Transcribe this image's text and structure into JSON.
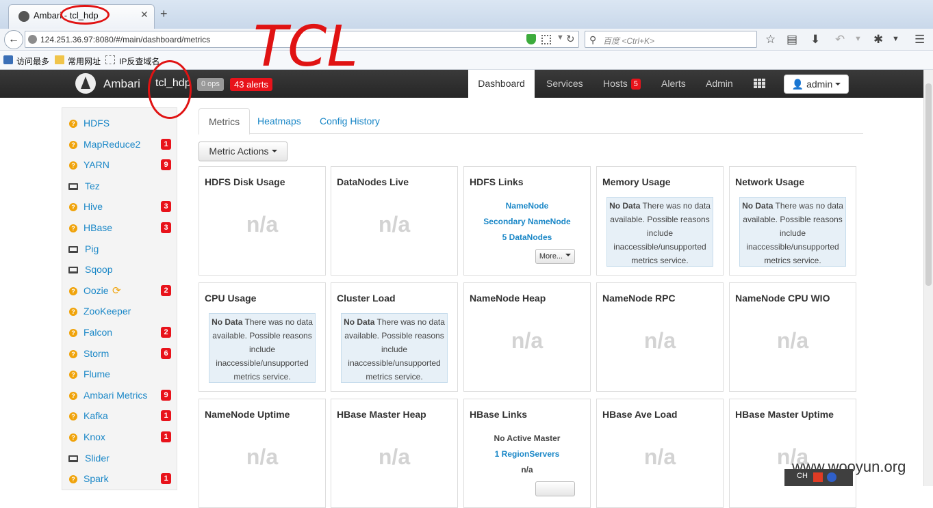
{
  "browser": {
    "tab_title": "Ambari - tcl_hdp",
    "url": "124.251.36.97:8080/#/main/dashboard/metrics",
    "search_placeholder": "百度 <Ctrl+K>",
    "bookmarks": [
      "访问最多",
      "常用网址",
      "IP反查域名"
    ]
  },
  "topnav": {
    "brand": "Ambari",
    "cluster": "tcl_hdp",
    "ops": "0 ops",
    "alerts": "43 alerts",
    "items": [
      "Dashboard",
      "Services",
      "Hosts",
      "Alerts",
      "Admin"
    ],
    "hosts_badge": "5",
    "user": "admin"
  },
  "annotation_text": "TCL",
  "sidebar": {
    "services": [
      {
        "name": "HDFS",
        "icon": "question-icon",
        "badge": ""
      },
      {
        "name": "MapReduce2",
        "icon": "question-icon",
        "badge": "1"
      },
      {
        "name": "YARN",
        "icon": "question-icon",
        "badge": "9"
      },
      {
        "name": "Tez",
        "icon": "laptop-icon",
        "badge": ""
      },
      {
        "name": "Hive",
        "icon": "question-icon",
        "badge": "3"
      },
      {
        "name": "HBase",
        "icon": "question-icon",
        "badge": "3"
      },
      {
        "name": "Pig",
        "icon": "laptop-icon",
        "badge": ""
      },
      {
        "name": "Sqoop",
        "icon": "laptop-icon",
        "badge": ""
      },
      {
        "name": "Oozie",
        "icon": "question-icon",
        "badge": "2"
      },
      {
        "name": "ZooKeeper",
        "icon": "question-icon",
        "badge": ""
      },
      {
        "name": "Falcon",
        "icon": "question-icon",
        "badge": "2"
      },
      {
        "name": "Storm",
        "icon": "question-icon",
        "badge": "6"
      },
      {
        "name": "Flume",
        "icon": "question-icon",
        "badge": ""
      },
      {
        "name": "Ambari Metrics",
        "icon": "question-icon",
        "badge": "9"
      },
      {
        "name": "Kafka",
        "icon": "question-icon",
        "badge": "1"
      },
      {
        "name": "Knox",
        "icon": "question-icon",
        "badge": "1"
      },
      {
        "name": "Slider",
        "icon": "laptop-icon",
        "badge": ""
      },
      {
        "name": "Spark",
        "icon": "question-icon",
        "badge": "1"
      }
    ]
  },
  "main": {
    "tabs": [
      "Metrics",
      "Heatmaps",
      "Config History"
    ],
    "metric_actions": "Metric Actions",
    "na": "n/a",
    "nodata_bold": "No Data",
    "nodata_text": " There was no data available. Possible reasons include inaccessible/unsupported metrics service.",
    "widgets": [
      {
        "title": "HDFS Disk Usage"
      },
      {
        "title": "DataNodes Live"
      },
      {
        "title": "HDFS Links",
        "links": [
          "NameNode",
          "Secondary NameNode",
          "5 DataNodes"
        ],
        "more": "More..."
      },
      {
        "title": "Memory Usage"
      },
      {
        "title": "Network Usage"
      },
      {
        "title": "CPU Usage"
      },
      {
        "title": "Cluster Load"
      },
      {
        "title": "NameNode Heap"
      },
      {
        "title": "NameNode RPC"
      },
      {
        "title": "NameNode CPU WIO"
      },
      {
        "title": "NameNode Uptime"
      },
      {
        "title": "HBase Master Heap"
      },
      {
        "title": "HBase Links",
        "lines": [
          "No Active Master",
          "1 RegionServers",
          "n/a"
        ]
      },
      {
        "title": "HBase Ave Load"
      },
      {
        "title": "HBase Master Uptime"
      }
    ]
  },
  "watermark": "www.wooyun.org",
  "ime": {
    "lang": "CH"
  }
}
